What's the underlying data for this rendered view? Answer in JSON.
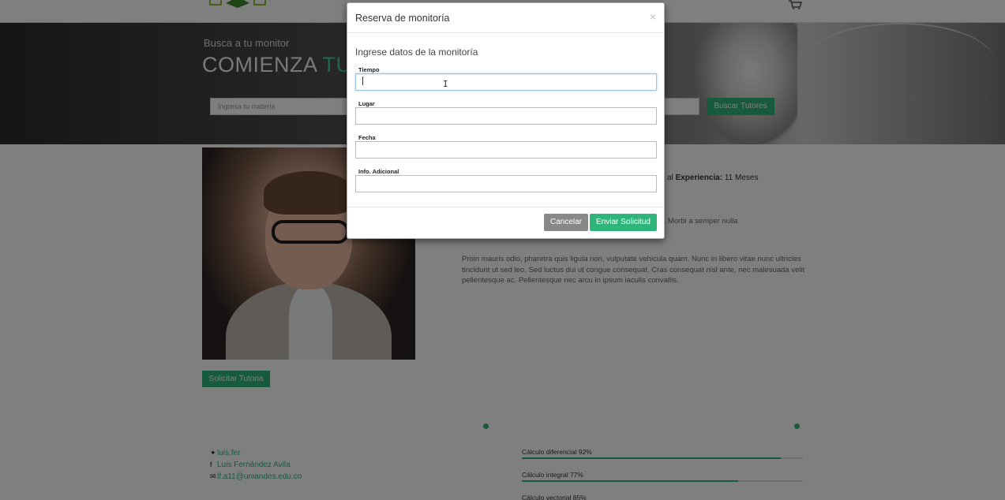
{
  "hero": {
    "subtitle": "Busca a tu monitor",
    "title_main": "COMIENZA ",
    "title_accent": "TU",
    "search_placeholder": "Ingresa tu materia",
    "search_button": "Buscar Tutores"
  },
  "profile": {
    "experience_prefix": "al ",
    "experience_label": "Experiencia:",
    "experience_value": " 11 Meses",
    "paragraph1": "spendisse eget massa nec turpis congue um commodo nunc. Morbi a semper nulla",
    "paragraph2": "Proin mauris odio, pharetra quis ligula non, vulputate vehicula quam. Nunc in libero vitae nunc ultricies tincidunt ut sed leo. Sed luctus dui ut congue consequat. Cras consequat nisl ante, nec malesuada velit pellentesque ac. Pellentesque nec arcu in ipsum iaculis convallis.",
    "request_button": "Solicitar Tutoria"
  },
  "contact": {
    "twitter": "luis.fer",
    "facebook": "Luis Fernández Avila",
    "email": "lf.a11@uniandes.edu.co"
  },
  "skills": [
    {
      "label": "Cálculo diferencial 92%",
      "percent": 92
    },
    {
      "label": "Cálculo integral 77%",
      "percent": 77
    },
    {
      "label": "Cálculo vectorial 85%",
      "percent": 85
    }
  ],
  "modal": {
    "title": "Reserva de monitoría",
    "close": "×",
    "subtitle": "Ingrese datos de la monitoría",
    "fields": [
      {
        "label": "Tiempo",
        "value": ""
      },
      {
        "label": "Lugar",
        "value": ""
      },
      {
        "label": "Fecha",
        "value": ""
      },
      {
        "label": "Info. Adicional",
        "value": ""
      }
    ],
    "cancel_button": "Cancelar",
    "submit_button": "Enviar Solicitud"
  },
  "colors": {
    "accent": "#2fb57a",
    "cancel": "#888888"
  }
}
